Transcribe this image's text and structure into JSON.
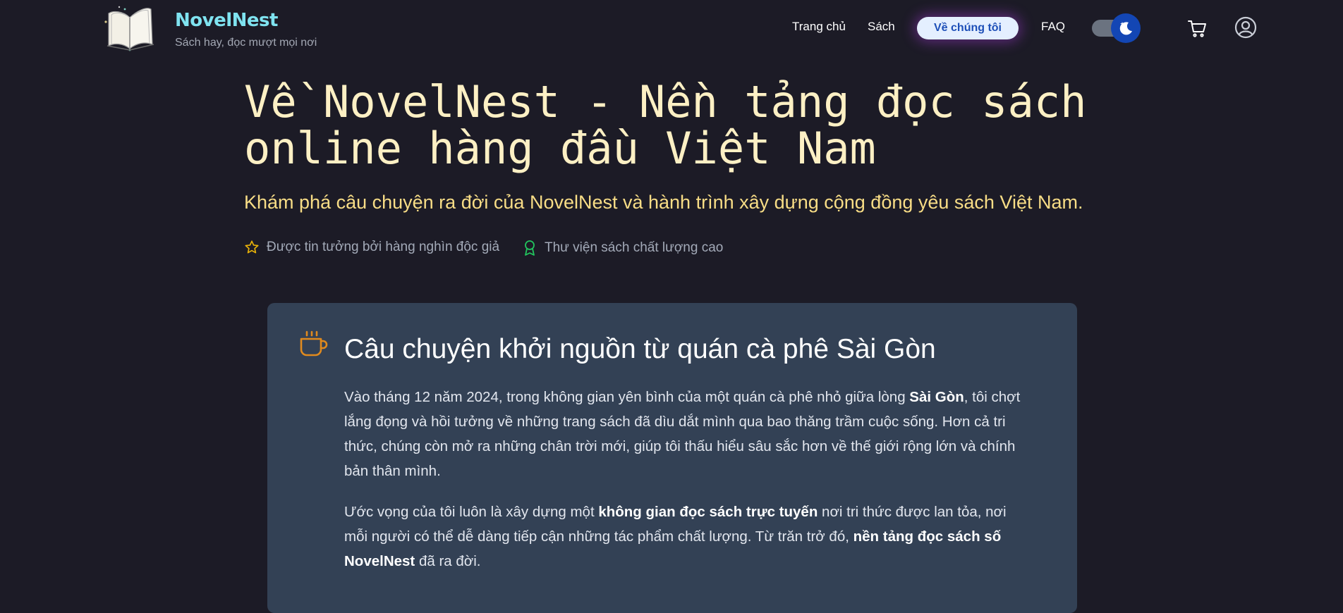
{
  "brand": {
    "name": "NovelNest",
    "tagline": "Sách hay, đọc mượt mọi nơi"
  },
  "nav": {
    "items": [
      {
        "label": "Trang chủ"
      },
      {
        "label": "Sách"
      },
      {
        "label": "Về chúng tôi",
        "active": true
      },
      {
        "label": "FAQ"
      }
    ],
    "theme_toggle": "dark",
    "cart_icon": "cart-icon",
    "account_icon": "user-circle-icon"
  },
  "hero": {
    "title_line1": "Về NovelNest - Nền tảng đọc sách",
    "title_line2": "online hàng đầu Việt Nam",
    "subtitle": "Khám phá câu chuyện ra đời của NovelNest và hành trình xây dựng cộng đồng yêu sách Việt Nam.",
    "badges": [
      {
        "icon": "star-icon",
        "label": "Được tin tưởng bởi hàng nghìn độc giả"
      },
      {
        "icon": "award-icon",
        "label": "Thư viện sách chất lượng cao"
      }
    ]
  },
  "story": {
    "icon": "coffee-cup-icon",
    "title": "Câu chuyện khởi nguồn từ quán cà phê Sài Gòn",
    "p1": [
      "Vào tháng 12 năm 2024, trong không gian yên bình của một quán cà phê nhỏ giữa lòng ",
      "Sài Gòn",
      ", tôi chợt lắng đọng và hồi tưởng về những trang sách đã dìu dắt mình qua bao thăng trầm cuộc sống. Hơn cả tri thức, chúng còn mở ra những chân trời mới, giúp tôi thấu hiểu sâu sắc hơn về thế giới rộng lớn và chính bản thân mình."
    ],
    "p2": [
      "Ước vọng của tôi luôn là xây dựng một ",
      "không gian đọc sách trực tuyến",
      " nơi tri thức được lan tỏa, nơi mỗi người có thể dễ dàng tiếp cận những tác phẩm chất lượng. Từ trăn trở đó, ",
      "nền tảng đọc sách số NovelNest",
      " đã ra đời."
    ]
  },
  "colors": {
    "background": "#1c1b26",
    "brand": "#7fe3f0",
    "hero_title": "#fdf0c4",
    "hero_subtitle": "#f8dd86",
    "card": "#334155",
    "accent_orange": "#e08a1e",
    "accent_green": "#22c55e",
    "nav_active_bg": "#e4efff",
    "nav_active_text": "#1d4fb8"
  }
}
